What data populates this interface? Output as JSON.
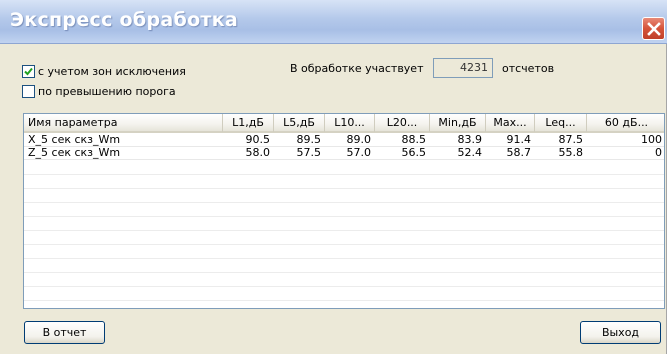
{
  "window": {
    "title": "Экспресс обработка"
  },
  "options": {
    "exclude_zones_label": "с учетом зон исключения",
    "exclude_zones_checked": true,
    "threshold_label": "по превышению порога",
    "threshold_checked": false
  },
  "count": {
    "label": "В обработке участвует",
    "value": "4231",
    "suffix": "отсчетов"
  },
  "table": {
    "columns": [
      "Имя параметра",
      "L1,дБ",
      "L5,дБ",
      "L10...",
      "L20...",
      "Min,дБ",
      "Max...",
      "Leq...",
      "60 дБ..."
    ],
    "rows": [
      [
        "X_5 сек скз_Wm",
        "90.5",
        "89.5",
        "89.0",
        "88.5",
        "83.9",
        "91.4",
        "87.5",
        "100"
      ],
      [
        "Z_5 сек скз_Wm",
        "58.0",
        "57.5",
        "57.0",
        "56.5",
        "52.4",
        "58.7",
        "55.8",
        "0"
      ]
    ]
  },
  "buttons": {
    "report": "В отчет",
    "exit": "Выход"
  }
}
